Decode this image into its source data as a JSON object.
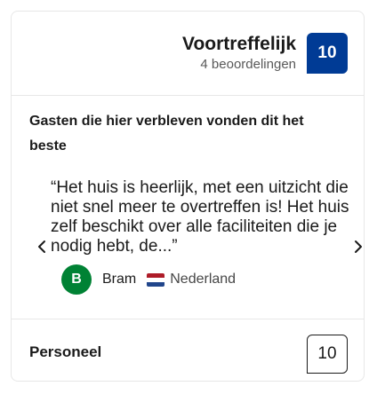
{
  "header": {
    "rating_word": "Voortreffelijk",
    "review_count": "4 beoordelingen",
    "score": "10",
    "score_color": "#003b95"
  },
  "highlights": {
    "title": "Gasten die hier verbleven vonden dit het beste",
    "quote": "“Het huis is heerlijk, met een uitzicht die niet snel meer te overtreffen is! Het huis zelf beschikt over alle faciliteiten die je nodig hebt, de...”",
    "prev_icon": "chevron-left-icon",
    "next_icon": "chevron-right-icon",
    "reviewer": {
      "initial": "B",
      "name": "Bram",
      "country": "Nederland",
      "flag_icon": "netherlands-flag-icon",
      "avatar_color": "#008234"
    }
  },
  "category": {
    "label": "Personeel",
    "score": "10"
  }
}
